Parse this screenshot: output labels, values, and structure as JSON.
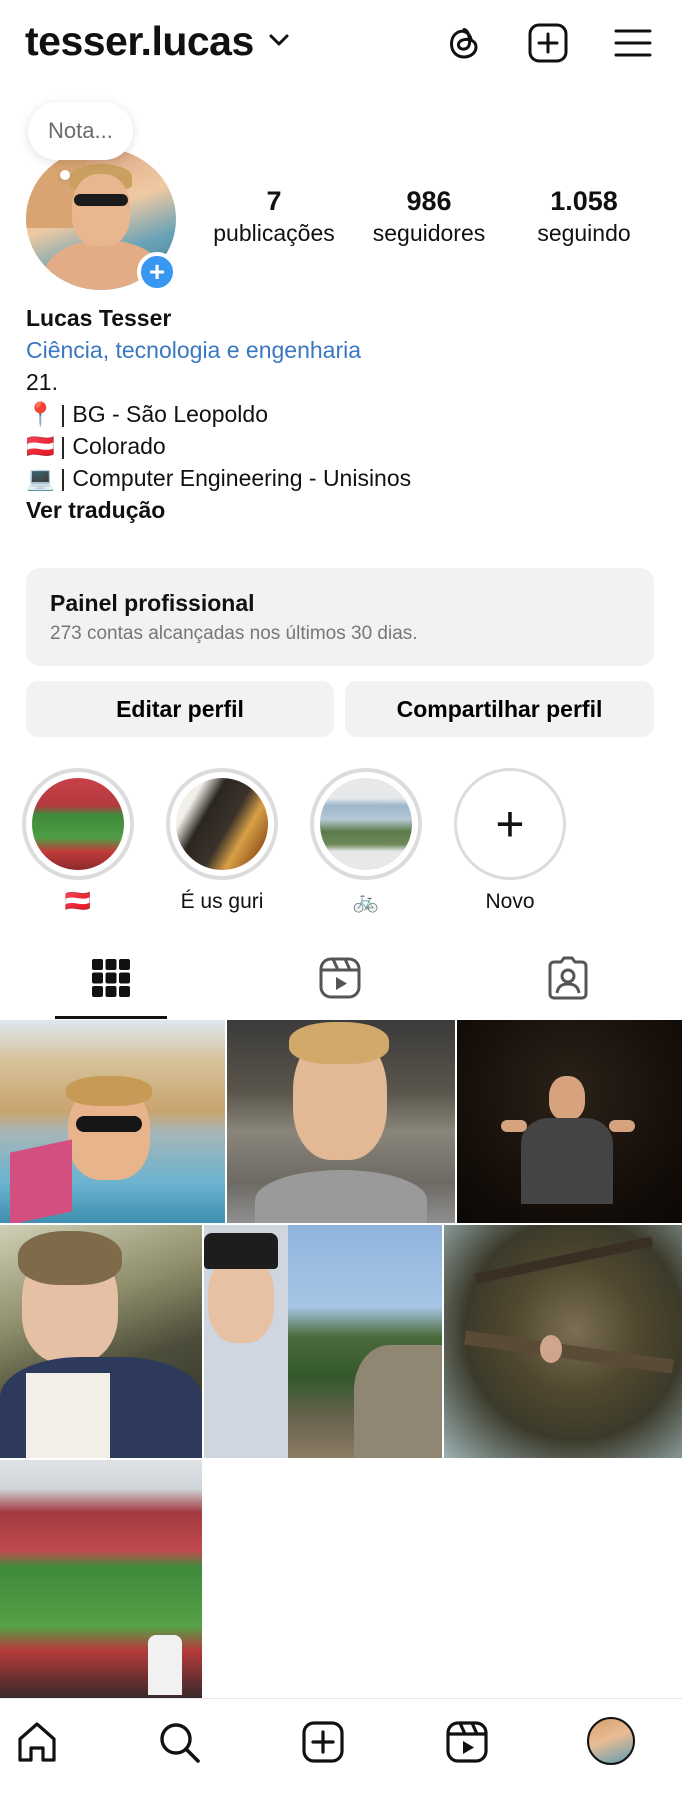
{
  "header": {
    "username": "tesser.lucas",
    "icons": [
      "threads-icon",
      "create-icon",
      "menu-icon"
    ]
  },
  "profile": {
    "note_placeholder": "Nota...",
    "stats": [
      {
        "value": "7",
        "label": "publicações"
      },
      {
        "value": "986",
        "label": "seguidores"
      },
      {
        "value": "1.058",
        "label": "seguindo"
      }
    ],
    "name": "Lucas Tesser",
    "category": "Ciência, tecnologia e engenharia",
    "bio_lines": [
      {
        "emoji": "",
        "text": "21."
      },
      {
        "emoji": "📍",
        "text": "| BG - São Leopoldo"
      },
      {
        "emoji": "🇦🇹",
        "text": "| Colorado"
      },
      {
        "emoji": "💻",
        "text": "| Computer Engineering - Unisinos"
      }
    ],
    "translate_label": "Ver tradução"
  },
  "pro_panel": {
    "title": "Painel profissional",
    "subtitle": "273 contas alcançadas nos últimos 30 dias."
  },
  "buttons": {
    "edit": "Editar perfil",
    "share": "Compartilhar perfil"
  },
  "highlights": [
    {
      "caption": "🇦🇹"
    },
    {
      "caption": "É us guri"
    },
    {
      "caption": "🚲"
    },
    {
      "caption": "Novo"
    }
  ],
  "tabs": [
    "grid-tab",
    "reels-tab",
    "tagged-tab"
  ],
  "colors": {
    "accent_blue": "#3897f0",
    "link_blue": "#3a77c2",
    "panel_gray": "#f1f2f4"
  },
  "bottom_nav": [
    "home-icon",
    "search-icon",
    "create-icon",
    "reels-icon",
    "profile-avatar"
  ]
}
